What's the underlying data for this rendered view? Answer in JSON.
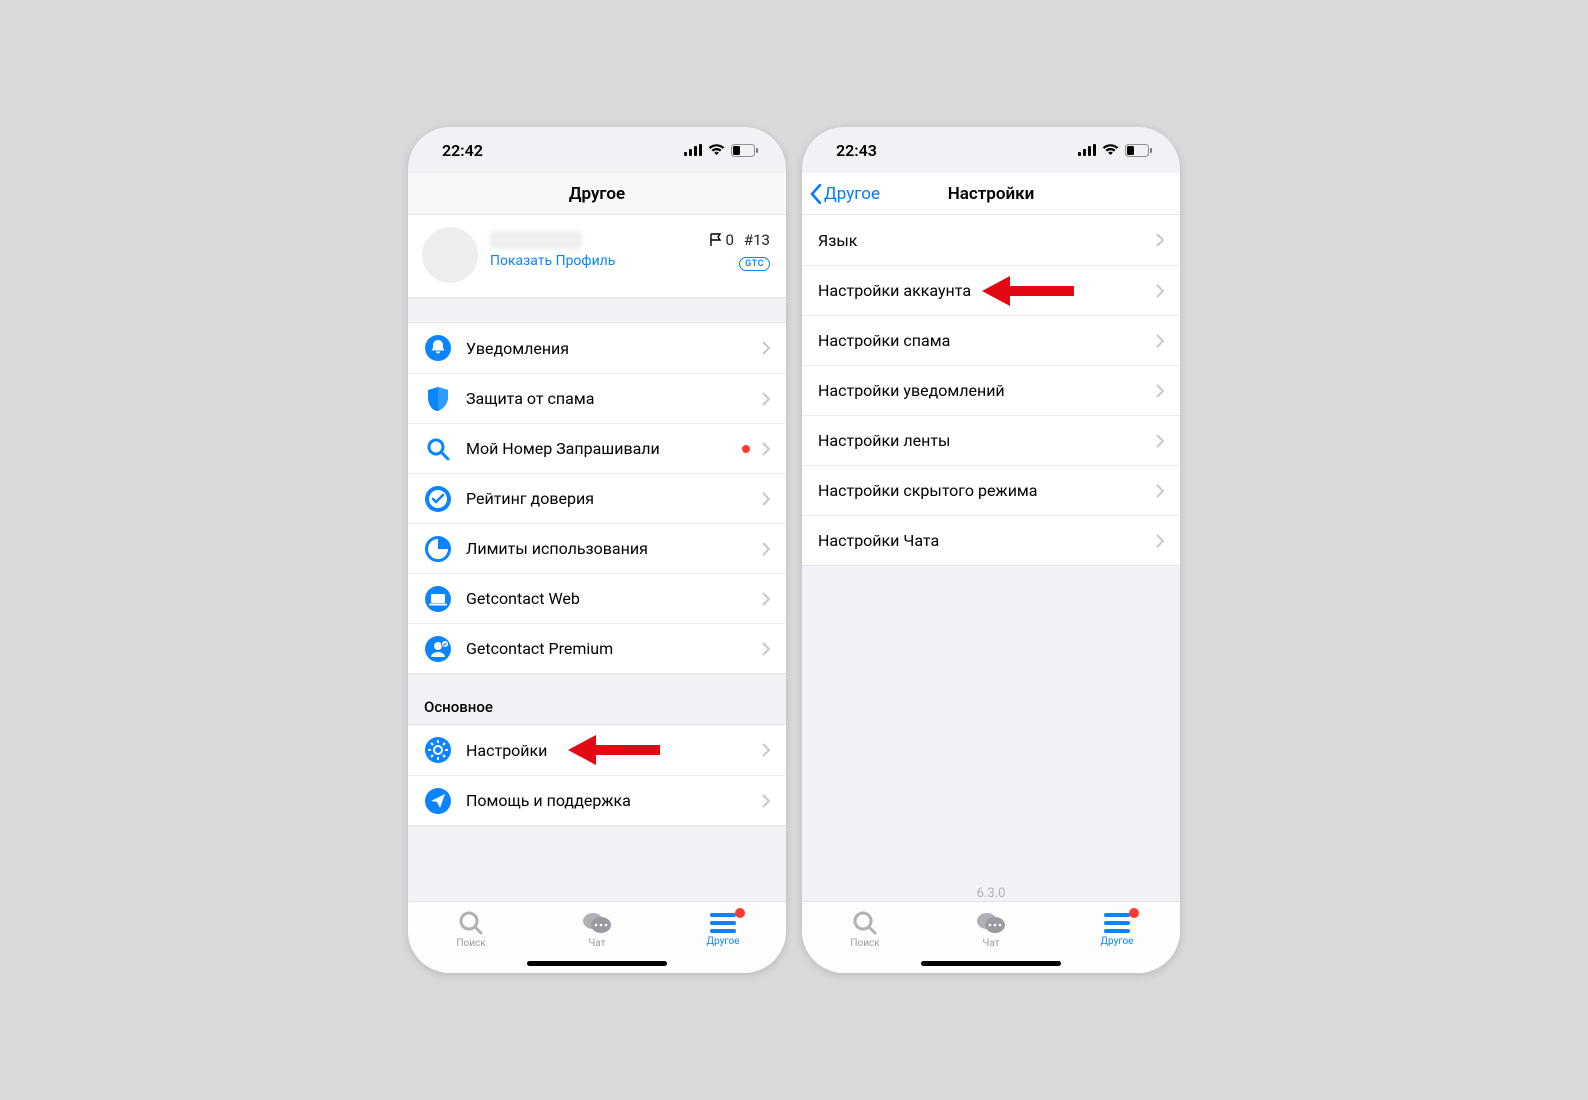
{
  "left": {
    "statusbar": {
      "time": "22:42"
    },
    "header": {
      "title": "Другое"
    },
    "profile": {
      "show_profile": "Показать Профиль",
      "flag_count": "0",
      "hash_count": "#13",
      "badge": "GTC"
    },
    "menu1": [
      {
        "icon": "bell",
        "label": "Уведомления"
      },
      {
        "icon": "shield",
        "label": "Защита от спама"
      },
      {
        "icon": "search",
        "label": "Мой Номер Запрашивали",
        "dot": true
      },
      {
        "icon": "check-badge",
        "label": "Рейтинг доверия"
      },
      {
        "icon": "pie",
        "label": "Лимиты использования"
      },
      {
        "icon": "laptop",
        "label": "Getcontact Web"
      },
      {
        "icon": "premium",
        "label": "Getcontact Premium"
      }
    ],
    "section2_label": "Основное",
    "menu2": [
      {
        "icon": "gear",
        "label": "Настройки",
        "arrow": true
      },
      {
        "icon": "send",
        "label": "Помощь и поддержка"
      }
    ],
    "tabs": {
      "search": "Поиск",
      "chat": "Чат",
      "other": "Другое"
    }
  },
  "right": {
    "statusbar": {
      "time": "22:43"
    },
    "header": {
      "back": "Другое",
      "title": "Настройки"
    },
    "rows": [
      {
        "label": "Язык"
      },
      {
        "label": "Настройки аккаунта",
        "arrow": true
      },
      {
        "label": "Настройки спама"
      },
      {
        "label": "Настройки уведомлений"
      },
      {
        "label": "Настройки ленты"
      },
      {
        "label": "Настройки скрытого режима"
      },
      {
        "label": "Настройки Чата"
      }
    ],
    "version": "6.3.0",
    "tabs": {
      "search": "Поиск",
      "chat": "Чат",
      "other": "Другое"
    }
  }
}
